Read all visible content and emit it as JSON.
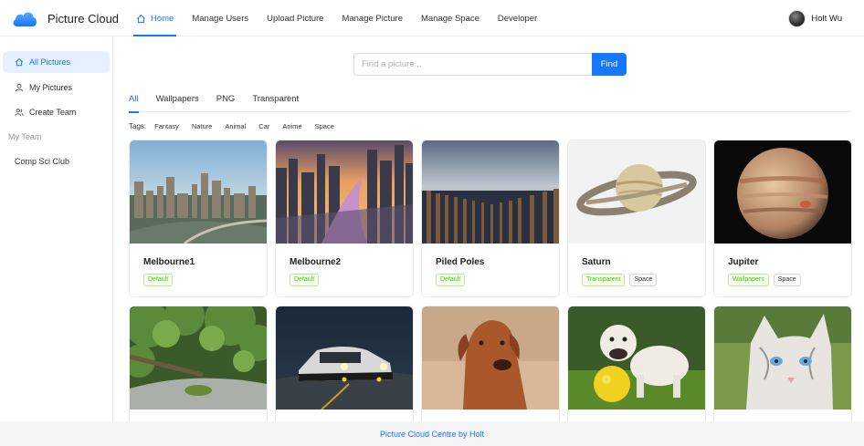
{
  "brand": {
    "name": "Picture Cloud",
    "logo_icon": "cloud-icon",
    "accent": "#1677ff"
  },
  "nav": [
    {
      "label": "Home",
      "active": true
    },
    {
      "label": "Manage Users"
    },
    {
      "label": "Upload Picture"
    },
    {
      "label": "Manage Picture"
    },
    {
      "label": "Manage Space"
    },
    {
      "label": "Developer"
    }
  ],
  "user": {
    "name": "Holt Wu"
  },
  "sidebar": {
    "items": [
      {
        "label": "All Pictures",
        "icon": "picture-icon",
        "active": true
      },
      {
        "label": "My Pictures",
        "icon": "user-icon"
      },
      {
        "label": "Create Team",
        "icon": "team-icon"
      }
    ],
    "group_label": "My Team",
    "teams": [
      {
        "label": "Comp Sci Club"
      }
    ]
  },
  "search": {
    "placeholder": "Find a picture...",
    "button_label": "Find"
  },
  "tabs": [
    {
      "label": "All",
      "active": true
    },
    {
      "label": "Wallpapers"
    },
    {
      "label": "PNG"
    },
    {
      "label": "Transparent"
    }
  ],
  "tags": {
    "label": "Tags:",
    "items": [
      "Fantasy",
      "Nature",
      "Animal",
      "Car",
      "Anime",
      "Space"
    ]
  },
  "pictures": [
    {
      "title": "Melbourne1",
      "tags": [
        {
          "label": "Default",
          "color": "green"
        }
      ]
    },
    {
      "title": "Melbourne2",
      "tags": [
        {
          "label": "Default",
          "color": "green"
        }
      ]
    },
    {
      "title": "Piled Poles",
      "tags": [
        {
          "label": "Default",
          "color": "green"
        }
      ]
    },
    {
      "title": "Saturn",
      "tags": [
        {
          "label": "Transparent",
          "color": "green"
        },
        {
          "label": "Space",
          "color": "default"
        }
      ]
    },
    {
      "title": "Jupiter",
      "tags": [
        {
          "label": "Wallpapers",
          "color": "green"
        },
        {
          "label": "Space",
          "color": "default"
        }
      ]
    },
    {
      "title": "",
      "tags": []
    },
    {
      "title": "",
      "tags": []
    },
    {
      "title": "",
      "tags": []
    },
    {
      "title": "",
      "tags": []
    },
    {
      "title": "",
      "tags": []
    }
  ],
  "footer": {
    "text": "Picture Cloud Centre by Holt"
  }
}
